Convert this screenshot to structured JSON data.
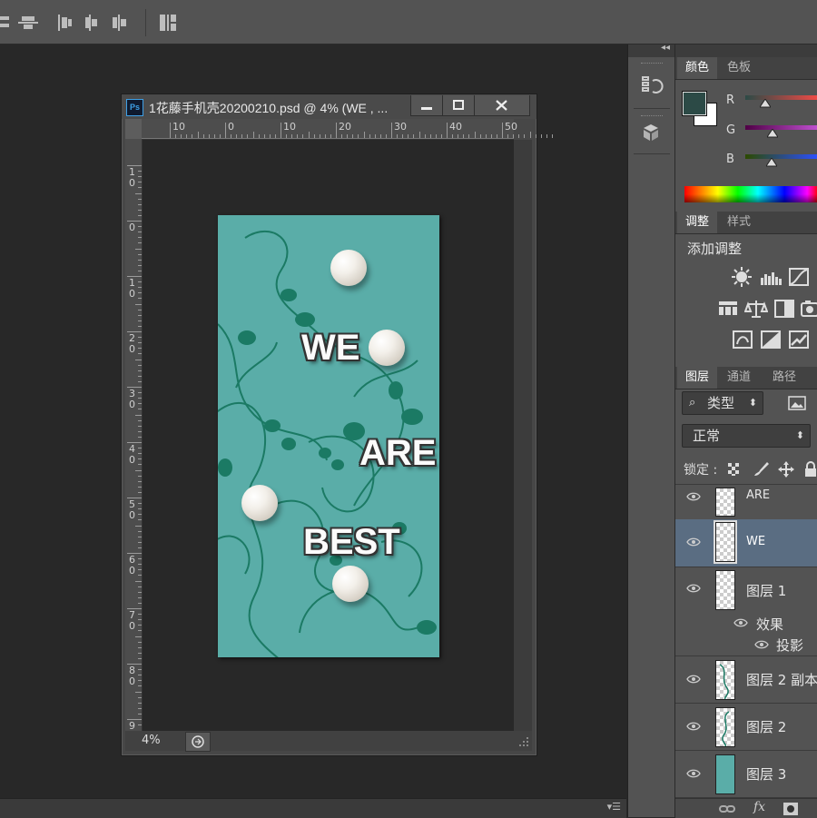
{
  "document": {
    "title": "1花藤手机壳20200210.psd @ 4% (WE , ...",
    "ps_logo": "Ps",
    "zoom": "4%",
    "ruler_top_labels": [
      "10",
      "0",
      "10",
      "20",
      "30",
      "40",
      "50"
    ],
    "ruler_left_labels": [
      "10",
      "0",
      "10",
      "20",
      "30",
      "40",
      "50",
      "60",
      "70",
      "80",
      "9"
    ],
    "window_buttons": [
      "minimize",
      "maximize",
      "close"
    ]
  },
  "artwork": {
    "texts": [
      "WE",
      "ARE",
      "BEST"
    ],
    "background_color": "#5aada8",
    "vine_color": "#1b7a64"
  },
  "color_panel": {
    "tabs": [
      "颜色",
      "色板"
    ],
    "active_tab": "颜色",
    "channels": [
      "R",
      "G",
      "B"
    ],
    "foreground": "#2c4a46",
    "background": "#ffffff"
  },
  "adjust_panel": {
    "tabs": [
      "调整",
      "样式"
    ],
    "active_tab": "调整",
    "heading": "添加调整"
  },
  "layers_panel": {
    "tabs": [
      "图层",
      "通道",
      "路径"
    ],
    "active_tab": "图层",
    "filter_label": "类型",
    "blend_mode": "正常",
    "lock_label": "锁定 :",
    "layers": [
      {
        "name": "ARE",
        "type": "text",
        "selected": false
      },
      {
        "name": "WE",
        "type": "text",
        "selected": true
      },
      {
        "name": "图层 1",
        "type": "raster",
        "selected": false
      },
      {
        "name": "效果",
        "type": "effects",
        "selected": false
      },
      {
        "name": "投影",
        "type": "effect",
        "selected": false
      },
      {
        "name": "图层 2 副本",
        "type": "raster",
        "selected": false
      },
      {
        "name": "图层 2",
        "type": "raster",
        "selected": false
      },
      {
        "name": "图层 3",
        "type": "fill",
        "selected": false
      }
    ],
    "bottom_icons": [
      "link-icon",
      "fx-icon",
      "mask-icon"
    ],
    "fx_label": "fx"
  }
}
